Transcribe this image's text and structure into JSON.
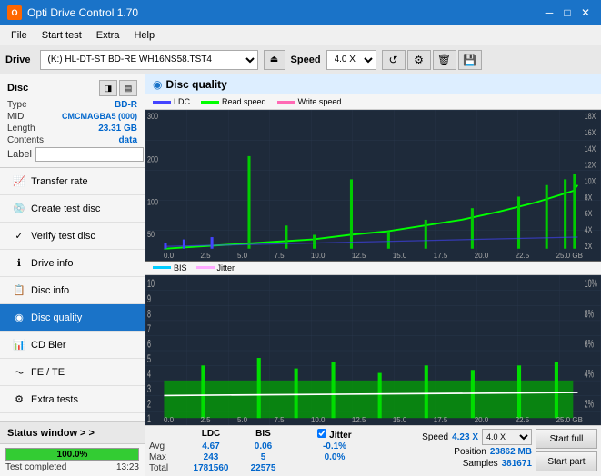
{
  "titlebar": {
    "title": "Opti Drive Control 1.70",
    "icon": "O",
    "minimize": "─",
    "maximize": "□",
    "close": "✕"
  },
  "menubar": {
    "items": [
      "File",
      "Start test",
      "Extra",
      "Help"
    ]
  },
  "drivebar": {
    "label": "Drive",
    "drive_value": "(K:)  HL-DT-ST BD-RE  WH16NS58.TST4",
    "speed_label": "Speed",
    "speed_value": "4.0 X",
    "eject_icon": "⏏"
  },
  "disc_panel": {
    "type_label": "Type",
    "type_value": "BD-R",
    "mid_label": "MID",
    "mid_value": "CMCMAGBA5 (000)",
    "length_label": "Length",
    "length_value": "23.31 GB",
    "contents_label": "Contents",
    "contents_value": "data",
    "label_label": "Label"
  },
  "nav": {
    "items": [
      {
        "id": "transfer-rate",
        "label": "Transfer rate",
        "icon": "📈"
      },
      {
        "id": "create-test-disc",
        "label": "Create test disc",
        "icon": "💿"
      },
      {
        "id": "verify-test-disc",
        "label": "Verify test disc",
        "icon": "✓"
      },
      {
        "id": "drive-info",
        "label": "Drive info",
        "icon": "ℹ"
      },
      {
        "id": "disc-info",
        "label": "Disc info",
        "icon": "📋"
      },
      {
        "id": "disc-quality",
        "label": "Disc quality",
        "icon": "◉",
        "active": true
      },
      {
        "id": "cd-bler",
        "label": "CD Bler",
        "icon": "📊"
      },
      {
        "id": "fe-te",
        "label": "FE / TE",
        "icon": "〜"
      },
      {
        "id": "extra-tests",
        "label": "Extra tests",
        "icon": "⚙"
      }
    ]
  },
  "status_window": {
    "label": "Status window > >"
  },
  "progress": {
    "value": 100,
    "text": "100.0%",
    "status_text": "Test completed",
    "time": "13:23"
  },
  "content": {
    "title": "Disc quality",
    "legend": {
      "ldc_label": "LDC",
      "ldc_color": "#0000ff",
      "read_speed_label": "Read speed",
      "read_speed_color": "#00ff00",
      "write_speed_label": "Write speed",
      "write_speed_color": "#ff69b4"
    },
    "chart1": {
      "y_max": 300,
      "y_labels_left": [
        "300",
        "200",
        "100",
        "50"
      ],
      "y_labels_right": [
        "18X",
        "16X",
        "14X",
        "12X",
        "10X",
        "8X",
        "6X",
        "4X",
        "2X"
      ],
      "x_labels": [
        "0.0",
        "2.5",
        "5.0",
        "7.5",
        "10.0",
        "12.5",
        "15.0",
        "17.5",
        "20.0",
        "22.5",
        "25.0 GB"
      ]
    },
    "chart2": {
      "legend": {
        "bis_label": "BIS",
        "jitter_label": "Jitter"
      },
      "y_labels_left": [
        "10",
        "9",
        "8",
        "7",
        "6",
        "5",
        "4",
        "3",
        "2",
        "1"
      ],
      "y_labels_right": [
        "10%",
        "8%",
        "6%",
        "4%",
        "2%"
      ],
      "x_labels": [
        "0.0",
        "2.5",
        "5.0",
        "7.5",
        "10.0",
        "12.5",
        "15.0",
        "17.5",
        "20.0",
        "22.5",
        "25.0 GB"
      ]
    },
    "stats": {
      "headers": [
        "LDC",
        "BIS",
        "",
        "Jitter"
      ],
      "avg_label": "Avg",
      "avg_ldc": "4.67",
      "avg_bis": "0.06",
      "avg_jitter": "-0.1%",
      "max_label": "Max",
      "max_ldc": "243",
      "max_bis": "5",
      "max_jitter": "0.0%",
      "total_label": "Total",
      "total_ldc": "1781560",
      "total_bis": "22575",
      "jitter_checked": true,
      "jitter_check_label": "Jitter",
      "speed_label": "Speed",
      "speed_value": "4.23 X",
      "speed_select": "4.0 X",
      "position_label": "Position",
      "position_value": "23862 MB",
      "samples_label": "Samples",
      "samples_value": "381671",
      "start_full_label": "Start full",
      "start_part_label": "Start part"
    }
  }
}
